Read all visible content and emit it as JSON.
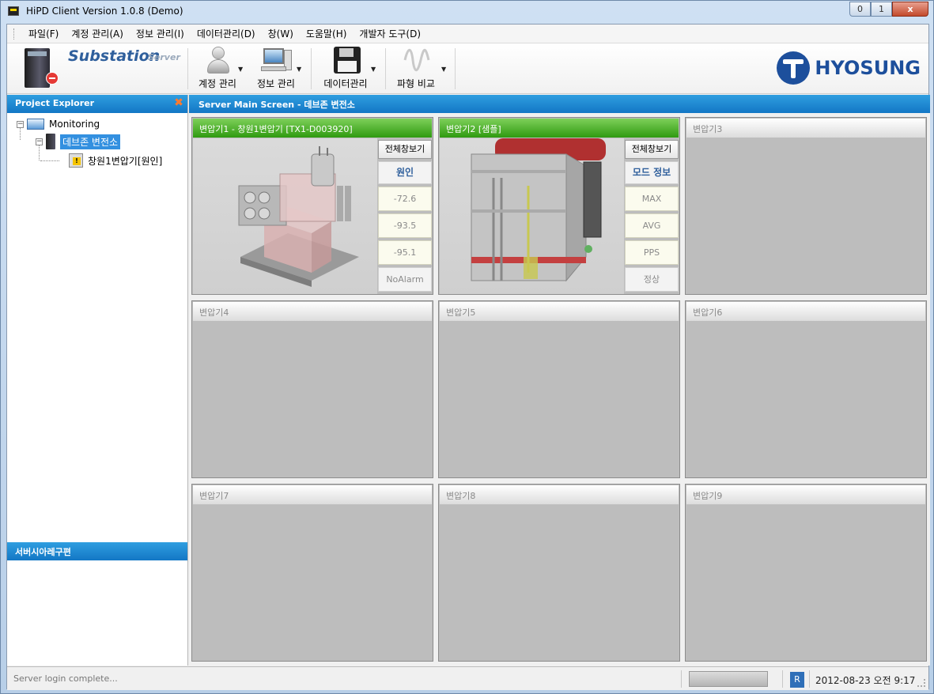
{
  "window": {
    "title": "HiPD Client Version 1.0.8 (Demo)",
    "minimize": "0",
    "maximize": "1",
    "close": "x"
  },
  "menu": [
    {
      "label": "파일(F)"
    },
    {
      "label": "계정 관리(A)"
    },
    {
      "label": "정보 관리(I)"
    },
    {
      "label": "데이터관리(D)"
    },
    {
      "label": "창(W)"
    },
    {
      "label": "도움말(H)"
    },
    {
      "label": "개발자 도구(D)"
    }
  ],
  "toolbar": {
    "brand": "Substation",
    "brand_sub": "Server",
    "account_label": "계정 관리",
    "info_label": "정보 관리",
    "data_label": "데이터관리",
    "wave_label": "파형 비교",
    "dropdown": "▼",
    "company": "HYOSUNG"
  },
  "project_explorer": {
    "title": "Project Explorer",
    "close": "✖",
    "tree": {
      "root": "Monitoring",
      "station": "데브존 변전소",
      "transformer": "창원1변압기[원인]"
    }
  },
  "bottom_panel": {
    "title": "서버시아레구편"
  },
  "main": {
    "title": "Server Main Screen - 데브존 변전소",
    "cards": [
      {
        "title": "변압기1 - 창원1변압기 [TX1-D003920]",
        "view_button": "전체창보기",
        "mode": "원인",
        "values": [
          "-72.6",
          "-93.5",
          "-95.1"
        ],
        "status": "NoAlarm"
      },
      {
        "title": "변압기2 [샘플]",
        "view_button": "전체창보기",
        "mode": "모드 정보",
        "values": [
          "MAX",
          "AVG",
          "PPS"
        ],
        "status": "정상"
      },
      {
        "title": "변압기3"
      },
      {
        "title": "변압기4"
      },
      {
        "title": "변압기5"
      },
      {
        "title": "변압기6"
      },
      {
        "title": "변압기7"
      },
      {
        "title": "변압기8"
      },
      {
        "title": "변압기9"
      }
    ]
  },
  "statusbar": {
    "message": "Server login complete...",
    "indicator": "R",
    "datetime": "2012-08-23 오전 9:17"
  },
  "colors": {
    "panel_header": "#1f8bd6",
    "active_card_header": "#3aa51a",
    "brand_blue": "#2f5f9c",
    "hyosung_blue": "#1d4f9c"
  }
}
